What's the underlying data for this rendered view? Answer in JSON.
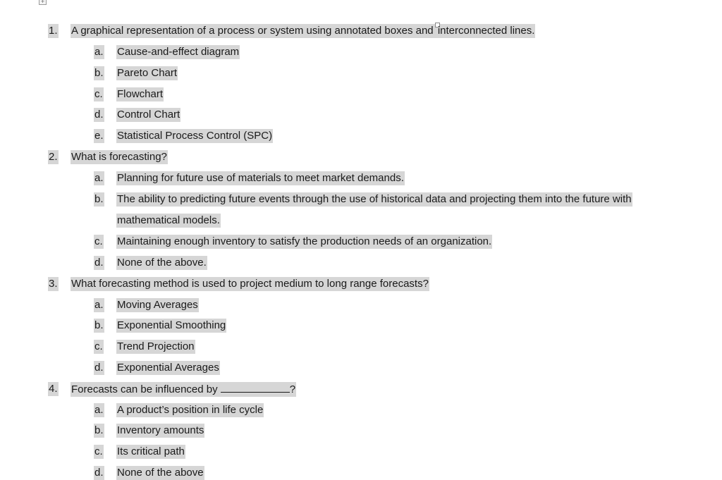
{
  "anchor_icon": "move-handle-icon",
  "questions": [
    {
      "number": "1.",
      "text_part1": "A graphical representation of a process or system using annotated boxes and",
      "text_part2": "interconnected lines.",
      "options": [
        {
          "letter": "a.",
          "text": "Cause-and-effect diagram"
        },
        {
          "letter": "b.",
          "text": "Pareto Chart"
        },
        {
          "letter": "c.",
          "text": "Flowchart"
        },
        {
          "letter": "d.",
          "text": "Control Chart"
        },
        {
          "letter": "e.",
          "text": "Statistical Process Control (SPC)"
        }
      ]
    },
    {
      "number": "2.",
      "text": "What is forecasting?",
      "options": [
        {
          "letter": "a.",
          "text": "Planning for future use of materials to meet market demands."
        },
        {
          "letter": "b.",
          "text": "The ability to predicting future events through the use of historical data and projecting them into the future with",
          "text_cont": "mathematical models."
        },
        {
          "letter": "c.",
          "text": "Maintaining enough inventory to satisfy the production needs of an organization."
        },
        {
          "letter": "d.",
          "text": "None of the above."
        }
      ]
    },
    {
      "number": "3.",
      "text": "What forecasting method is used to project medium to long range forecasts?",
      "options": [
        {
          "letter": "a.",
          "text": "Moving Averages"
        },
        {
          "letter": "b.",
          "text": "Exponential Smoothing"
        },
        {
          "letter": "c.",
          "text": "Trend Projection"
        },
        {
          "letter": "d.",
          "text": "Exponential Averages"
        }
      ]
    },
    {
      "number": "4.",
      "text": "Forecasts can be influenced by",
      "text_suffix": "?",
      "options": [
        {
          "letter": "a.",
          "text": "A product’s position in life cycle"
        },
        {
          "letter": "b.",
          "text": "Inventory amounts"
        },
        {
          "letter": "c.",
          "text": "Its critical path"
        },
        {
          "letter": "d.",
          "text": "None of the above"
        }
      ]
    }
  ]
}
